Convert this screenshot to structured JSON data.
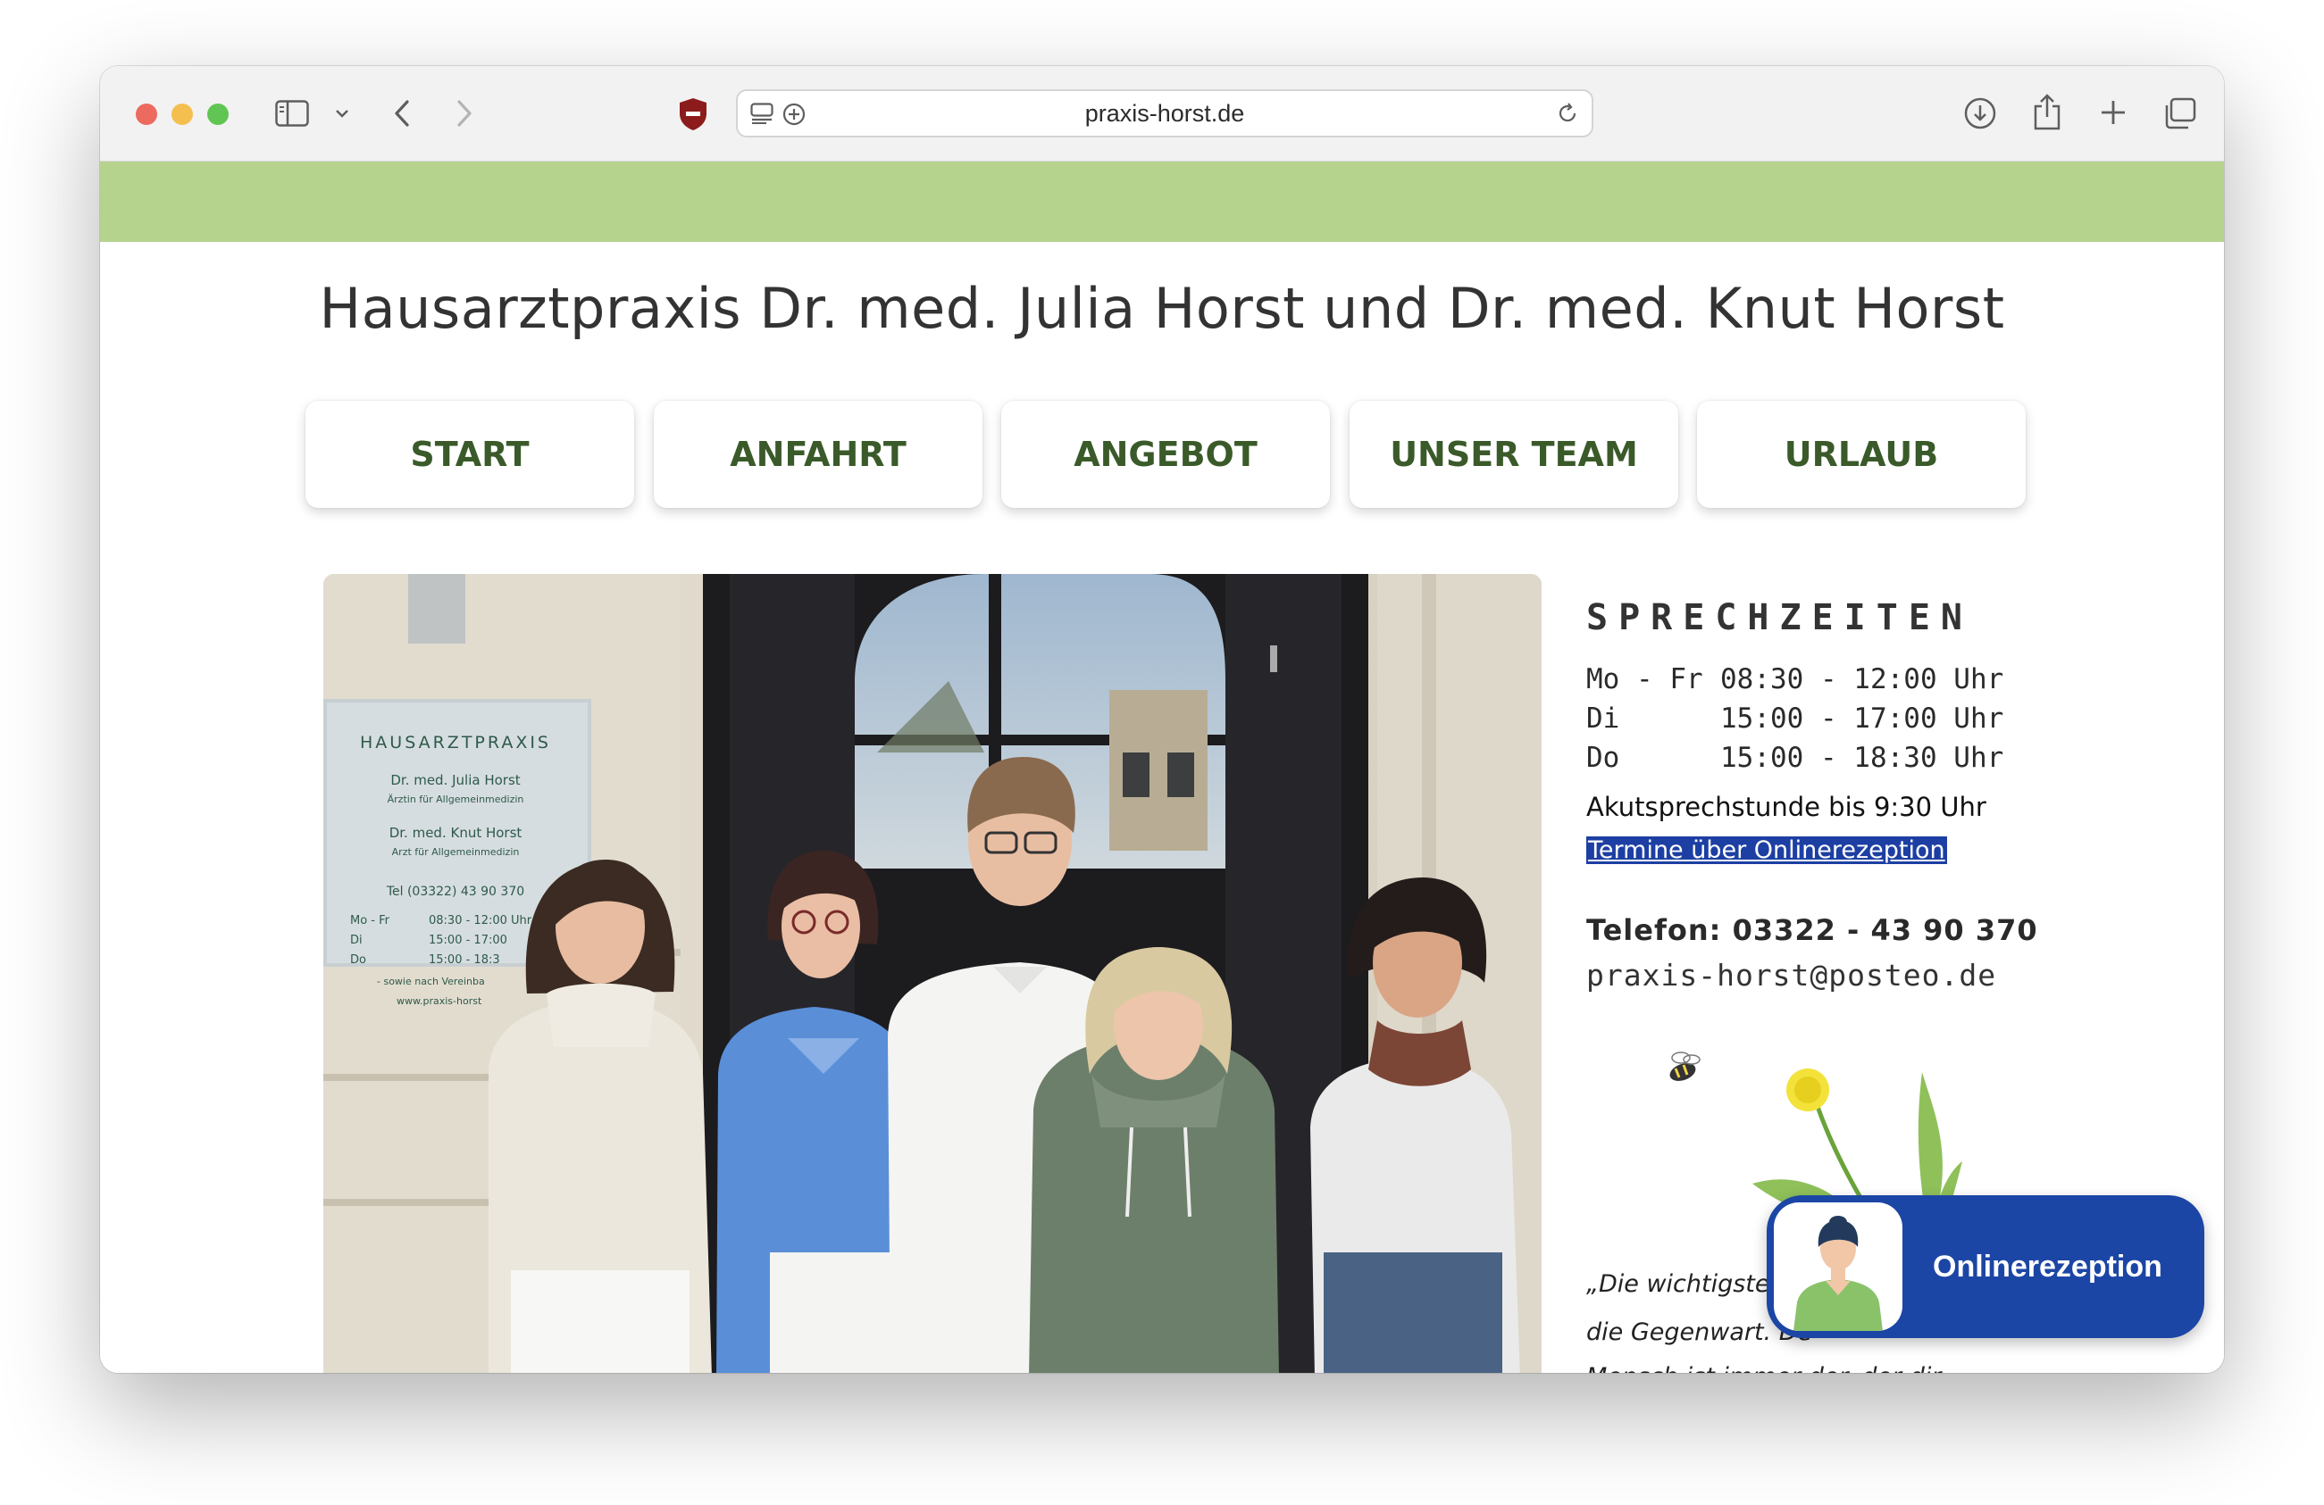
{
  "browser": {
    "url": "praxis-horst.de"
  },
  "site": {
    "title": "Hausarztpraxis Dr. med. Julia Horst und Dr. med. Knut Horst"
  },
  "nav": {
    "items": [
      {
        "label": "START"
      },
      {
        "label": "ANFAHRT"
      },
      {
        "label": "ANGEBOT"
      },
      {
        "label": "UNSER TEAM"
      },
      {
        "label": "URLAUB"
      }
    ]
  },
  "photo_sign": {
    "heading": "HAUSARZTPRAXIS",
    "doctor1": "Dr. med. Julia Horst",
    "doctor1_title": "Ärztin für Allgemeinmedizin",
    "doctor2": "Dr. med. Knut Horst",
    "doctor2_title": "Arzt für Allgemeinmedizin",
    "phone": "Tel  (03322) 43 90 370",
    "hours": [
      {
        "day": "Mo - Fr",
        "time": "08:30 - 12:00 Uhr"
      },
      {
        "day": "Di",
        "time": "15:00 - 17:00"
      },
      {
        "day": "Do",
        "time": "15:00 - 18:3"
      }
    ],
    "note": "- sowie nach Vereinba",
    "web": "www.praxis-horst"
  },
  "hours": {
    "heading": "SPRECHZEITEN",
    "rows": [
      {
        "day": "Mo - Fr",
        "time": "08:30 - 12:00 Uhr"
      },
      {
        "day": "Di",
        "time": "15:00 - 17:00 Uhr"
      },
      {
        "day": "Do",
        "time": "15:00 - 18:30 Uhr"
      }
    ],
    "acute": "Akutsprechstunde bis 9:30 Uhr",
    "appointment_link": "Termine über Onlinerezeption"
  },
  "contact": {
    "phone": "Telefon: 03322 - 43 90 370",
    "email": "praxis-horst@posteo.de"
  },
  "quote": {
    "line1": "„Die wichtigste",
    "line2": "die Gegenwart. De",
    "line3": "Mensch ist immer der, der dir"
  },
  "widget": {
    "label": "Onlinerezeption"
  },
  "colors": {
    "green_bar": "#b5d38d",
    "nav_text": "#3a5a2a",
    "widget_blue": "#1c46a5",
    "link_highlight": "#1d3fa3"
  },
  "icons": [
    "sidebar-icon",
    "chevron-down-icon",
    "back-icon",
    "forward-icon",
    "shield-icon",
    "reader-icon",
    "extension-icon",
    "reload-icon",
    "download-icon",
    "share-icon",
    "plus-icon",
    "tabs-icon",
    "bee-icon",
    "dandelion-icon",
    "avatar-icon"
  ]
}
